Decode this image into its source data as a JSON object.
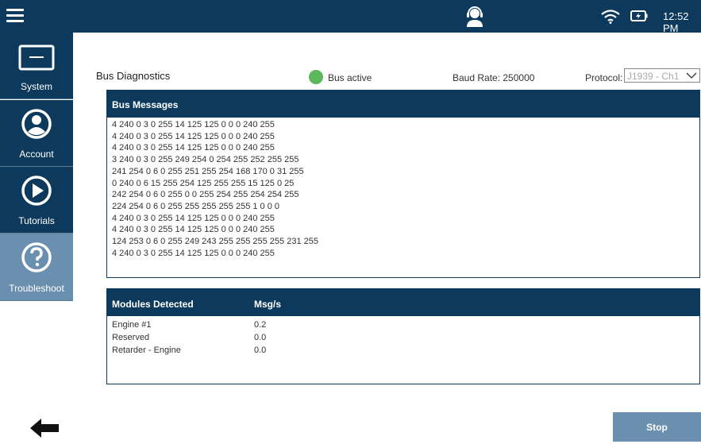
{
  "topbar": {
    "time": "12:52 PM",
    "icons": [
      "menu-icon",
      "support-headset-icon",
      "wifi-icon",
      "battery-icon"
    ]
  },
  "sidebar": {
    "items": [
      {
        "label": "System",
        "icon": "tablet-icon",
        "active": false
      },
      {
        "label": "Account",
        "icon": "user-icon",
        "active": false
      },
      {
        "label": "Tutorials",
        "icon": "play-icon",
        "active": false
      },
      {
        "label": "Troubleshoot",
        "icon": "help-icon",
        "active": true
      }
    ]
  },
  "header": {
    "title": "Bus Diagnostics",
    "bus_status": "Bus active",
    "bus_status_color": "#5cb85c",
    "baud_rate": "Baud Rate: 250000",
    "protocol_label": "Protocol:",
    "protocol_value": "J1939 - Ch1"
  },
  "bus_messages": {
    "heading": "Bus Messages",
    "lines": [
      "4 240 0 3 0 255 14 125 125 0 0 0 240 255",
      "4 240 0 3 0 255 14 125 125 0 0 0 240 255",
      "4 240 0 3 0 255 14 125 125 0 0 0 240 255",
      "3 240 0 3 0 255 249 254 0 254 255 252 255 255",
      "241 254 0 6 0 255 251 255 254 168 170 0 31 255",
      "0 240 0 6 15 255 254 125 255 255 15 125 0 25",
      "242 254 0 6 0 255 0 0 255 254 255 254 254 255",
      "224 254 0 6 0 255 255 255 255 255 1 0 0 0",
      "4 240 0 3 0 255 14 125 125 0 0 0 240 255",
      "4 240 0 3 0 255 14 125 125 0 0 0 240 255",
      "124 253 0 6 0 255 249 243 255 255 255 255 231 255",
      "4 240 0 3 0 255 14 125 125 0 0 0 240 255"
    ]
  },
  "modules": {
    "col_module": "Modules Detected",
    "col_rate": "Msg/s",
    "rows": [
      {
        "name": "Engine #1",
        "rate": "0.2"
      },
      {
        "name": "Reserved",
        "rate": "0.0"
      },
      {
        "name": "Retarder - Engine",
        "rate": "0.0"
      }
    ]
  },
  "footer": {
    "stop_label": "Stop"
  },
  "colors": {
    "brand_dark": "#0d3a5c",
    "active_item": "#6b8fae"
  }
}
